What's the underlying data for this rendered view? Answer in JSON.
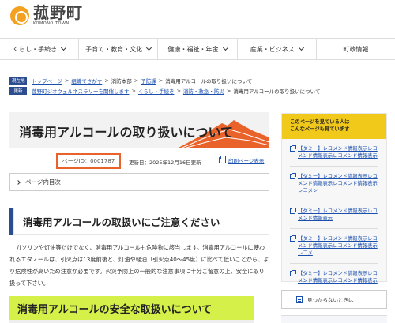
{
  "header": {
    "logo_text": "菰野町",
    "logo_sub": "KOMONO TOWN"
  },
  "nav": {
    "items": [
      "くらし・手続き",
      "子育て・教育・文化",
      "健康・福祉・年金",
      "産業・ビジネス",
      "町政情報"
    ]
  },
  "breadcrumbs": {
    "current_tag": "現在地",
    "current": [
      "トップページ",
      "組織でさがす",
      "消防本部",
      "予防課",
      "消毒用アルコールの取り扱いについて"
    ],
    "alt_tag": "更新",
    "alt": [
      "菰野町ジオウェルネスラリーを開催します",
      "くらし・手続き",
      "消防・救急・防災",
      "消毒用アルコールの取り扱いについて"
    ]
  },
  "article": {
    "title": "消毒用アルコールの取り扱いについて",
    "page_id": "ページID：0001787",
    "updated": "更新日：2025年12月16日更新",
    "print_label": "印刷ページ表示",
    "toc_label": "ページ内目次",
    "heading1": "消毒用アルコールの取扱いにご注意ください",
    "body": "ガソリンや灯油等だけでなく、消毒用アルコールも危険物に該当します。消毒用アルコールに使われるエタノールは、引火点は13度前後と、灯油や軽油（引火点40～45度）に比べて低いことから、より危険性が高いため注意が必要です。火災予防上の一般的な注意事項に十分ご留意の上、安全に取り扱って下さい。",
    "heading2": "消毒用アルコールの安全な取扱いについて"
  },
  "sidebar": {
    "heading_line1": "このページを見ている人は",
    "heading_line2": "こんなページも見ています",
    "links": [
      "【ダミー】レコメンド情報表示レコメンド情報表示レコメンド情報表示",
      "【ダミー】レコメンド情報表示レコメンド情報表示レコメンド情報表示レコメン",
      "【ダミー】レコメンド情報表示レコメンド情報表示",
      "【ダミー】レコメンド情報表示レコメンド情報表示レコメンド情報表示レコメ",
      "【ダミー】レコメンド情報表示レコメンド情報表示レコメンド情報表示"
    ],
    "not_found_label": "見つからないときは"
  },
  "colors": {
    "accent": "#e8622a",
    "nav_tag": "#2c4d8f",
    "sidebar_head": "#f1c91a",
    "heading2_bg": "#d6f04a",
    "link": "#1a4fae"
  }
}
